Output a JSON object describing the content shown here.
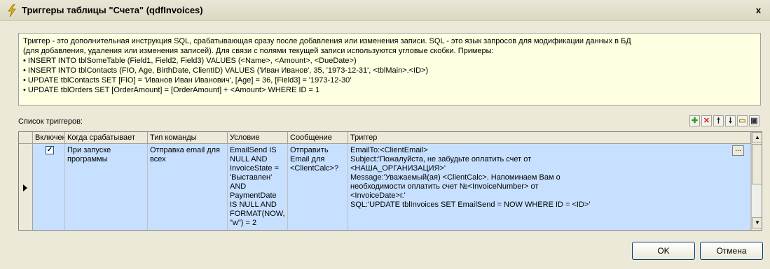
{
  "window": {
    "title": "Триггеры таблицы \"Счета\" (qdfInvoices)",
    "close_label": "x"
  },
  "description": {
    "lines": [
      "Триггер - это дополнительная инструкция SQL, срабатывающая сразу после добавления или изменения записи. SQL - это язык запросов для модификации данных в БД",
      "(для добавления, удаления или изменения записей). Для связи с полями текущей записи используются угловые скобки. Примеры:",
      "• INSERT INTO tblSomeTable (Field1, Field2, Field3) VALUES (<Name>, <Amount>, <DueDate>)",
      "• INSERT INTO tblContacts (FIO, Age, BirthDate, ClientID) VALUES ('Иван Иванов', 35, '1973-12-31', <tblMain>.<ID>)",
      "• UPDATE tblContacts SET [FIO] = 'Иванов Иван Иванович', [Age] = 36, [Field3] = '1973-12-30'",
      "• UPDATE tblOrders SET [OrderAmount] = [OrderAmount] + <Amount> WHERE ID = 1"
    ]
  },
  "list_label": "Список триггеров:",
  "toolbar": {
    "icons": [
      "add-icon",
      "delete-icon",
      "move-up-icon",
      "move-down-icon",
      "open-icon",
      "save-icon"
    ],
    "glyphs": [
      "✚",
      "✕",
      "🠕",
      "🠗",
      "▭",
      "▣"
    ]
  },
  "grid": {
    "columns": [
      "Включен",
      "Когда срабатывает",
      "Тип команды",
      "Условие",
      "Сообщение",
      "Триггер"
    ],
    "row": {
      "enabled": true,
      "check_glyph": "✓",
      "when": "При запуске программы",
      "command_type": "Отправка email для всех",
      "condition": "EmailSend IS NULL AND InvoiceState = 'Выставлен' AND PaymentDate IS NULL AND FORMAT(NOW, \"w\") = 2",
      "message": "Отправить Email для <ClientCalc>?",
      "trigger_lines": [
        "EmailTo:<ClientEmail>",
        "Subject:'Пожалуйста, не забудьте оплатить счет от",
        "<НАША_ОРГАНИЗАЦИЯ>'",
        "Message:'Уважаемый(ая) <ClientCalc>. Напоминаем Вам о",
        "необходимости оплатить счет №<InvoiceNumber> от",
        "<InvoiceDate>г.'",
        "SQL:'UPDATE tblInvoices SET EmailSend = NOW WHERE ID = <ID>'"
      ],
      "ellipsis_label": "..."
    },
    "scroll_up": "▲",
    "scroll_down": "▼"
  },
  "buttons": {
    "ok": "OK",
    "cancel": "Отмена"
  },
  "colors": {
    "selected_row": "#c7e0ff",
    "info_panel": "#ffffe1",
    "title_icon": "#e8b800"
  }
}
